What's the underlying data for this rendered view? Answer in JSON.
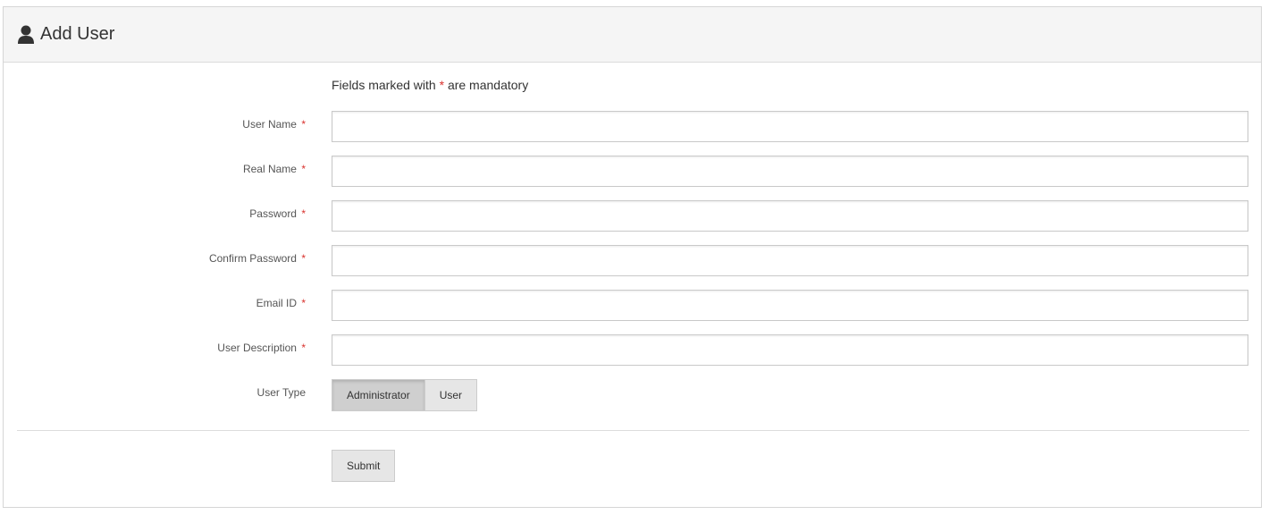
{
  "header": {
    "title": "Add User",
    "icon": "user-icon"
  },
  "form": {
    "note_prefix": "Fields marked with",
    "note_star": "*",
    "note_suffix": "are mandatory",
    "fields": [
      {
        "label": "User Name",
        "required": "*",
        "value": "",
        "placeholder": ""
      },
      {
        "label": "Real Name",
        "required": "*",
        "value": "",
        "placeholder": ""
      },
      {
        "label": "Password",
        "required": "*",
        "value": "",
        "placeholder": ""
      },
      {
        "label": "Confirm Password",
        "required": "*",
        "value": "",
        "placeholder": ""
      },
      {
        "label": "Email ID",
        "required": "*",
        "value": "",
        "placeholder": ""
      },
      {
        "label": "User Description",
        "required": "*",
        "value": "",
        "placeholder": ""
      }
    ],
    "user_type": {
      "label": "User Type",
      "options": [
        "Administrator",
        "User"
      ],
      "selected": "Administrator"
    },
    "submit_label": "Submit"
  },
  "colors": {
    "required": "#d9322e",
    "header_bg": "#f5f5f5",
    "active_button": "#cfcfcf",
    "button": "#e6e6e6"
  }
}
